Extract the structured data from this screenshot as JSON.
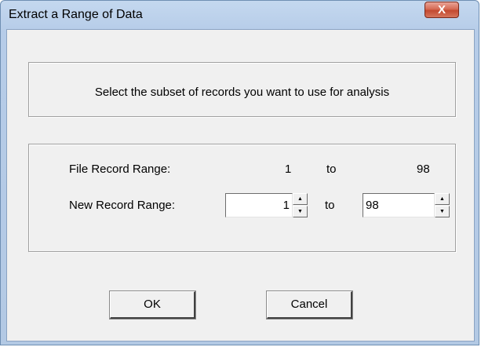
{
  "window": {
    "title": "Extract a Range of Data",
    "close_glyph": "X"
  },
  "instruction_text": "Select the subset of records you want to use for analysis",
  "file_range": {
    "label": "File Record Range:",
    "start": "1",
    "to_label": "to",
    "end": "98"
  },
  "new_range": {
    "label": "New Record Range:",
    "start_value": "1",
    "to_label": "to",
    "end_value": "98"
  },
  "buttons": {
    "ok_label": "OK",
    "cancel_label": "Cancel"
  },
  "icons": {
    "close": "close-icon",
    "spin_up": "spin-up-icon",
    "spin_down": "spin-down-icon"
  },
  "colors": {
    "client_background": "#f0f0f0",
    "titlebar": "#b6cce8",
    "close_button": "#c34a30"
  }
}
